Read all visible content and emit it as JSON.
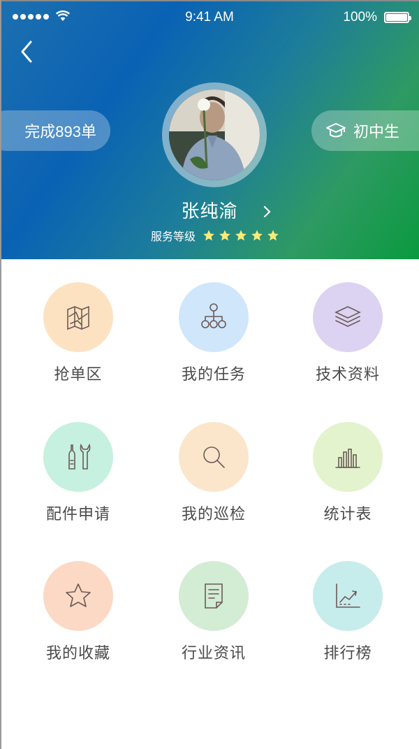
{
  "status_bar": {
    "time": "9:41 AM",
    "battery": "100%"
  },
  "profile": {
    "completed_label": "完成893单",
    "grade_label": "初中生",
    "name": "张纯渝",
    "service_level_label": "服务等级",
    "service_rating": 5,
    "service_rating_max": 5
  },
  "menu": {
    "items": [
      {
        "label": "抢单区",
        "icon": "map-icon",
        "color": "#fde2c2"
      },
      {
        "label": "我的任务",
        "icon": "org-chart-icon",
        "color": "#cfe6fb"
      },
      {
        "label": "技术资料",
        "icon": "layers-icon",
        "color": "#dcd3f2"
      },
      {
        "label": "配件申请",
        "icon": "tools-icon",
        "color": "#c6f0df"
      },
      {
        "label": "我的巡检",
        "icon": "search-icon",
        "color": "#fbe6cc"
      },
      {
        "label": "统计表",
        "icon": "bar-chart-icon",
        "color": "#e3f3cd"
      },
      {
        "label": "我的收藏",
        "icon": "star-icon",
        "color": "#fcd9c5"
      },
      {
        "label": "行业资讯",
        "icon": "news-icon",
        "color": "#d3ecd4"
      },
      {
        "label": "排行榜",
        "icon": "trend-chart-icon",
        "color": "#c6ecec"
      }
    ]
  },
  "colors": {
    "icon_stroke": "#6b5a55",
    "star": "#f7ec7a",
    "label": "#4a4a4a"
  }
}
